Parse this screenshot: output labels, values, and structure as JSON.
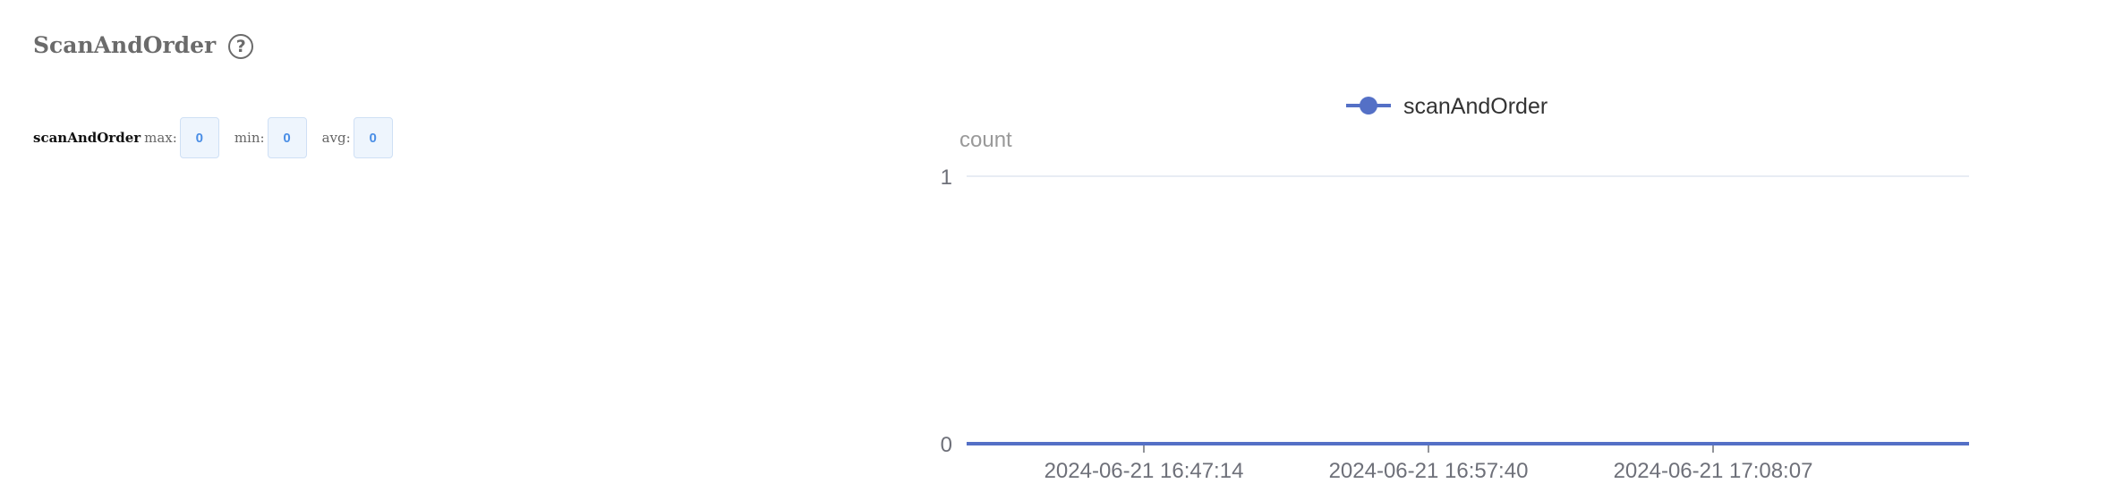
{
  "panel": {
    "title": "ScanAndOrder",
    "help_glyph": "?"
  },
  "stats": {
    "metric_name": "scanAndOrder",
    "max_label": "max:",
    "max_value": "0",
    "min_label": "min:",
    "min_value": "0",
    "avg_label": "avg:",
    "avg_value": "0"
  },
  "icons": {
    "help": "question-circle-icon"
  },
  "colors": {
    "series": "#5470c6",
    "grid": "#e0e6f1",
    "axis_text": "#6e7079",
    "title_text": "#6b6b6b",
    "stat_value": "#4a8ee6",
    "stat_box_bg": "#eef5fd",
    "stat_box_border": "#cfe0f5"
  },
  "chart_data": {
    "type": "line",
    "ylabel": "count",
    "ylim": [
      0,
      1
    ],
    "yticks": [
      "0",
      "1"
    ],
    "x_tick_labels": [
      "2024-06-21 16:47:14",
      "2024-06-21 16:57:40",
      "2024-06-21 17:08:07"
    ],
    "series": [
      {
        "name": "scanAndOrder",
        "values": [
          0,
          0,
          0
        ]
      }
    ],
    "legend": "top-center",
    "grid": true
  }
}
